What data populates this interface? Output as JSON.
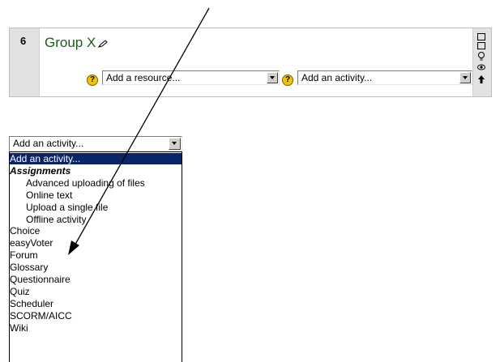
{
  "section": {
    "number": "6",
    "title": "Group X",
    "resource_select": {
      "value": "Add a resource..."
    },
    "activity_select": {
      "value": "Add an activity..."
    },
    "help_glyph": "?",
    "right_icons": [
      "hide-square-icon",
      "show-square-icon",
      "lightbulb-icon",
      "eye-icon",
      "move-up-arrow-icon"
    ]
  },
  "standalone_select": {
    "value": "Add an activity..."
  },
  "dropdown": {
    "items": [
      {
        "label": "Add an activity...",
        "kind": "selected"
      },
      {
        "label": "Assignments",
        "kind": "group"
      },
      {
        "label": "Advanced uploading of files",
        "kind": "option"
      },
      {
        "label": "Online text",
        "kind": "option"
      },
      {
        "label": "Upload a single file",
        "kind": "option"
      },
      {
        "label": "Offline activity",
        "kind": "option"
      },
      {
        "label": "Choice",
        "kind": "item"
      },
      {
        "label": "easyVoter",
        "kind": "item"
      },
      {
        "label": "Forum",
        "kind": "item"
      },
      {
        "label": "Glossary",
        "kind": "item"
      },
      {
        "label": "Questionnaire",
        "kind": "item"
      },
      {
        "label": "Quiz",
        "kind": "item"
      },
      {
        "label": "Scheduler",
        "kind": "item"
      },
      {
        "label": "SCORM/AICC",
        "kind": "item"
      },
      {
        "label": "Wiki",
        "kind": "item"
      }
    ]
  },
  "colors": {
    "selected_bg": "#0a246a",
    "section_sidebar": "#e2e2e2",
    "title": "#1a5a1a"
  }
}
